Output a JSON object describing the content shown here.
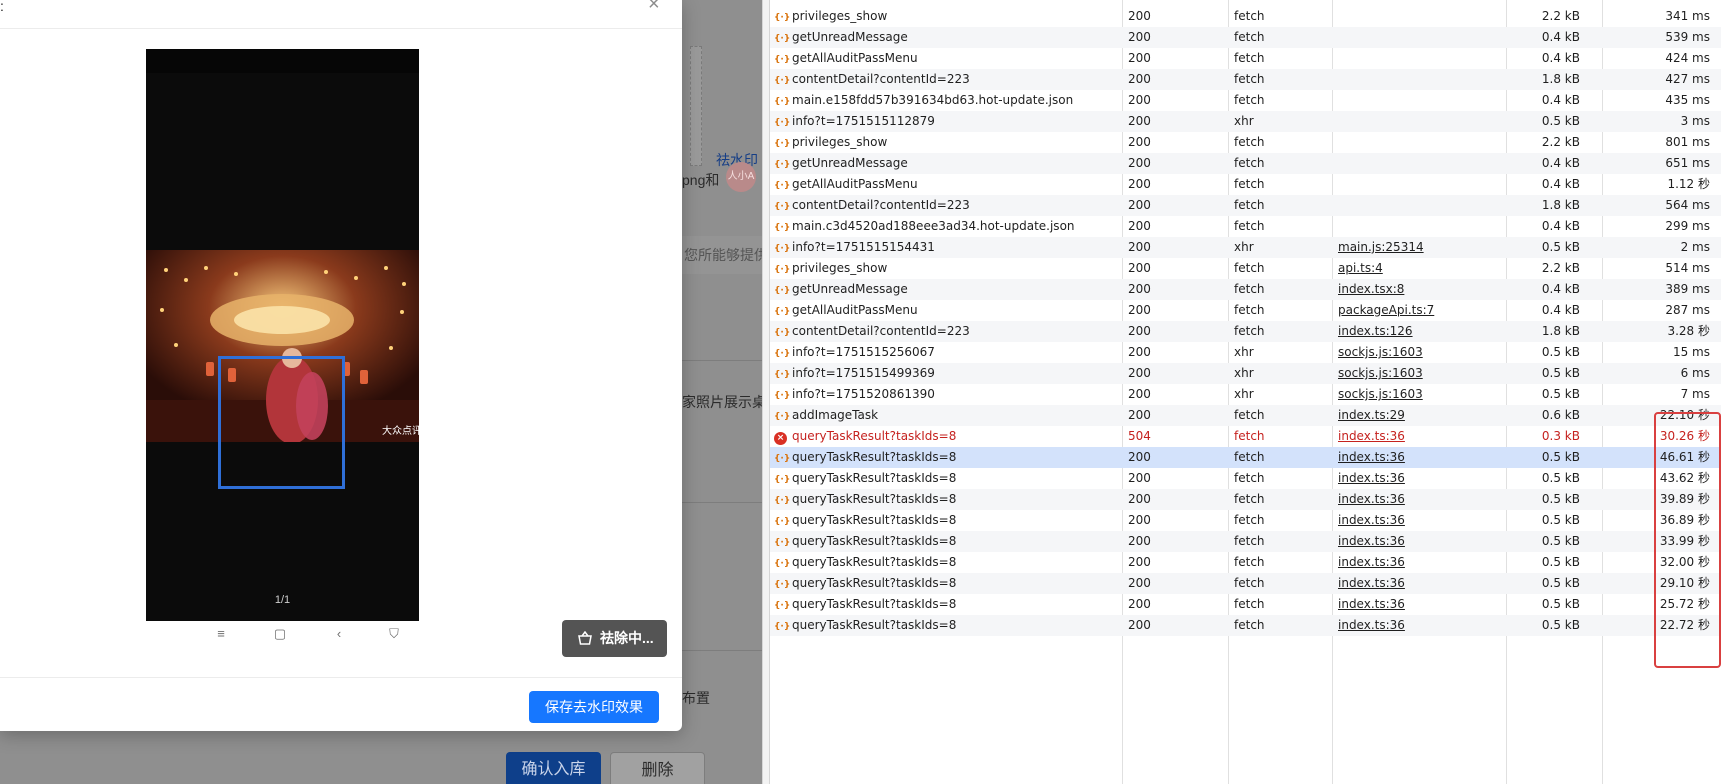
{
  "background_app": {
    "link_fragment": "祛水印",
    "upload_hint_fragment": "png和",
    "info_fragment": "您所能够提供的",
    "photo_fragment": "家照片展示桌布",
    "small_fragment": "布置",
    "avatar_text": "人小A",
    "confirm_label": "确认入库",
    "delete_label": "删除"
  },
  "modal": {
    "title_dot": ":",
    "close_icon": "×",
    "pager": "1/1",
    "nav_icons": [
      "≡",
      "▢",
      "‹",
      "⛉"
    ],
    "removing_label": "祛除中...",
    "save_label": "保存去水印效果",
    "watermark_text": "大众点评"
  },
  "network": {
    "rows": [
      {
        "name": "privileges_show",
        "status": "200",
        "type": "fetch",
        "initiator": "",
        "size": "2.2 kB",
        "time": "341 ms",
        "state": "normal"
      },
      {
        "name": "getUnreadMessage",
        "status": "200",
        "type": "fetch",
        "initiator": "",
        "size": "0.4 kB",
        "time": "539 ms",
        "state": "normal"
      },
      {
        "name": "getAllAuditPassMenu",
        "status": "200",
        "type": "fetch",
        "initiator": "",
        "size": "0.4 kB",
        "time": "424 ms",
        "state": "normal"
      },
      {
        "name": "contentDetail?contentId=223",
        "status": "200",
        "type": "fetch",
        "initiator": "",
        "size": "1.8 kB",
        "time": "427 ms",
        "state": "normal"
      },
      {
        "name": "main.e158fdd57b391634bd63.hot-update.json",
        "status": "200",
        "type": "fetch",
        "initiator": "",
        "size": "0.4 kB",
        "time": "435 ms",
        "state": "normal"
      },
      {
        "name": "info?t=1751515112879",
        "status": "200",
        "type": "xhr",
        "initiator": "",
        "size": "0.5 kB",
        "time": "3 ms",
        "state": "normal"
      },
      {
        "name": "privileges_show",
        "status": "200",
        "type": "fetch",
        "initiator": "",
        "size": "2.2 kB",
        "time": "801 ms",
        "state": "normal"
      },
      {
        "name": "getUnreadMessage",
        "status": "200",
        "type": "fetch",
        "initiator": "",
        "size": "0.4 kB",
        "time": "651 ms",
        "state": "normal"
      },
      {
        "name": "getAllAuditPassMenu",
        "status": "200",
        "type": "fetch",
        "initiator": "",
        "size": "0.4 kB",
        "time": "1.12 秒",
        "state": "normal"
      },
      {
        "name": "contentDetail?contentId=223",
        "status": "200",
        "type": "fetch",
        "initiator": "",
        "size": "1.8 kB",
        "time": "564 ms",
        "state": "normal"
      },
      {
        "name": "main.c3d4520ad188eee3ad34.hot-update.json",
        "status": "200",
        "type": "fetch",
        "initiator": "",
        "size": "0.4 kB",
        "time": "299 ms",
        "state": "normal"
      },
      {
        "name": "info?t=1751515154431",
        "status": "200",
        "type": "xhr",
        "initiator": "main.js:25314",
        "size": "0.5 kB",
        "time": "2 ms",
        "state": "normal"
      },
      {
        "name": "privileges_show",
        "status": "200",
        "type": "fetch",
        "initiator": "api.ts:4",
        "size": "2.2 kB",
        "time": "514 ms",
        "state": "normal"
      },
      {
        "name": "getUnreadMessage",
        "status": "200",
        "type": "fetch",
        "initiator": "index.tsx:8",
        "size": "0.4 kB",
        "time": "389 ms",
        "state": "normal"
      },
      {
        "name": "getAllAuditPassMenu",
        "status": "200",
        "type": "fetch",
        "initiator": "packageApi.ts:7",
        "size": "0.4 kB",
        "time": "287 ms",
        "state": "normal"
      },
      {
        "name": "contentDetail?contentId=223",
        "status": "200",
        "type": "fetch",
        "initiator": "index.ts:126",
        "size": "1.8 kB",
        "time": "3.28 秒",
        "state": "normal"
      },
      {
        "name": "info?t=1751515256067",
        "status": "200",
        "type": "xhr",
        "initiator": "sockjs.js:1603",
        "size": "0.5 kB",
        "time": "15 ms",
        "state": "normal"
      },
      {
        "name": "info?t=1751515499369",
        "status": "200",
        "type": "xhr",
        "initiator": "sockjs.js:1603",
        "size": "0.5 kB",
        "time": "6 ms",
        "state": "normal"
      },
      {
        "name": "info?t=1751520861390",
        "status": "200",
        "type": "xhr",
        "initiator": "sockjs.js:1603",
        "size": "0.5 kB",
        "time": "7 ms",
        "state": "normal"
      },
      {
        "name": "addImageTask",
        "status": "200",
        "type": "fetch",
        "initiator": "index.ts:29",
        "size": "0.6 kB",
        "time": "22.10 秒",
        "state": "normal"
      },
      {
        "name": "queryTaskResult?taskIds=8",
        "status": "504",
        "type": "fetch",
        "initiator": "index.ts:36",
        "size": "0.3 kB",
        "time": "30.26 秒",
        "state": "error"
      },
      {
        "name": "queryTaskResult?taskIds=8",
        "status": "200",
        "type": "fetch",
        "initiator": "index.ts:36",
        "size": "0.5 kB",
        "time": "46.61 秒",
        "state": "selected"
      },
      {
        "name": "queryTaskResult?taskIds=8",
        "status": "200",
        "type": "fetch",
        "initiator": "index.ts:36",
        "size": "0.5 kB",
        "time": "43.62 秒",
        "state": "normal"
      },
      {
        "name": "queryTaskResult?taskIds=8",
        "status": "200",
        "type": "fetch",
        "initiator": "index.ts:36",
        "size": "0.5 kB",
        "time": "39.89 秒",
        "state": "normal"
      },
      {
        "name": "queryTaskResult?taskIds=8",
        "status": "200",
        "type": "fetch",
        "initiator": "index.ts:36",
        "size": "0.5 kB",
        "time": "36.89 秒",
        "state": "normal"
      },
      {
        "name": "queryTaskResult?taskIds=8",
        "status": "200",
        "type": "fetch",
        "initiator": "index.ts:36",
        "size": "0.5 kB",
        "time": "33.99 秒",
        "state": "normal"
      },
      {
        "name": "queryTaskResult?taskIds=8",
        "status": "200",
        "type": "fetch",
        "initiator": "index.ts:36",
        "size": "0.5 kB",
        "time": "32.00 秒",
        "state": "normal"
      },
      {
        "name": "queryTaskResult?taskIds=8",
        "status": "200",
        "type": "fetch",
        "initiator": "index.ts:36",
        "size": "0.5 kB",
        "time": "29.10 秒",
        "state": "normal"
      },
      {
        "name": "queryTaskResult?taskIds=8",
        "status": "200",
        "type": "fetch",
        "initiator": "index.ts:36",
        "size": "0.5 kB",
        "time": "25.72 秒",
        "state": "normal"
      },
      {
        "name": "queryTaskResult?taskIds=8",
        "status": "200",
        "type": "fetch",
        "initiator": "index.ts:36",
        "size": "0.5 kB",
        "time": "22.72 秒",
        "state": "normal"
      }
    ],
    "fetch_icon": "{·}",
    "error_icon": "×",
    "colors": {
      "error": "#c5221f",
      "selected": "#d3e2fb",
      "highlight": "#d94040",
      "accent": "#1677ff"
    }
  }
}
